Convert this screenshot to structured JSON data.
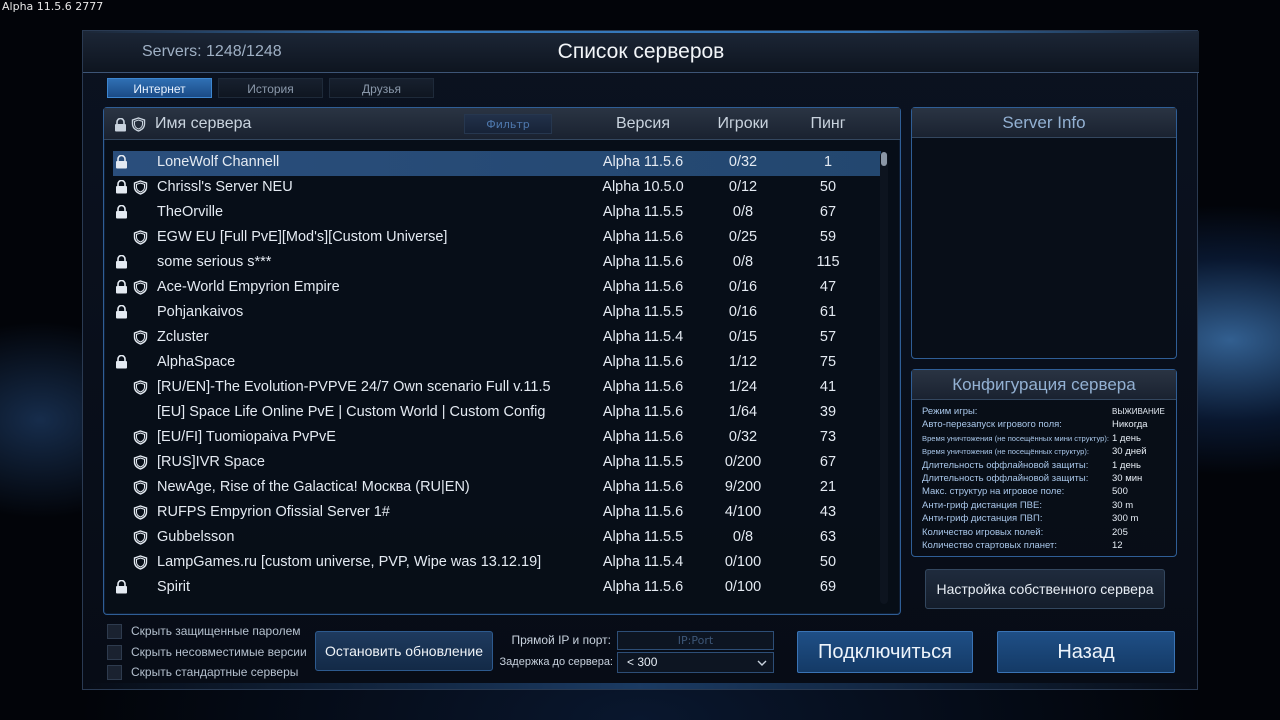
{
  "app": {
    "version_tag": "Alpha 11.5.6 2777"
  },
  "header": {
    "server_count": "Servers: 1248/1248",
    "title": "Список серверов"
  },
  "tabs": [
    {
      "label": "Интернет",
      "active": true
    },
    {
      "label": "История",
      "active": false
    },
    {
      "label": "Друзья",
      "active": false
    }
  ],
  "list": {
    "columns": {
      "name": "Имя сервера",
      "filter": "Фильтр",
      "version": "Версия",
      "players": "Игроки",
      "ping": "Пинг"
    },
    "selected_index": 0,
    "rows": [
      {
        "lock": true,
        "shield": false,
        "name": "LoneWolf Channell",
        "version": "Alpha 11.5.6",
        "players": "0/32",
        "ping": "1"
      },
      {
        "lock": true,
        "shield": true,
        "name": "Chrissl's Server NEU",
        "version": "Alpha 10.5.0",
        "players": "0/12",
        "ping": "50"
      },
      {
        "lock": true,
        "shield": false,
        "name": "TheOrville",
        "version": "Alpha 11.5.5",
        "players": "0/8",
        "ping": "67"
      },
      {
        "lock": false,
        "shield": true,
        "name": "EGW EU [Full PvE][Mod's][Custom Universe]",
        "version": "Alpha 11.5.6",
        "players": "0/25",
        "ping": "59"
      },
      {
        "lock": true,
        "shield": false,
        "name": "some serious s***",
        "version": "Alpha 11.5.6",
        "players": "0/8",
        "ping": "115"
      },
      {
        "lock": true,
        "shield": true,
        "name": "Ace-World Empyrion Empire",
        "version": "Alpha 11.5.6",
        "players": "0/16",
        "ping": "47"
      },
      {
        "lock": true,
        "shield": false,
        "name": "Pohjankaivos",
        "version": "Alpha 11.5.5",
        "players": "0/16",
        "ping": "61"
      },
      {
        "lock": false,
        "shield": true,
        "name": "Zcluster",
        "version": "Alpha 11.5.4",
        "players": "0/15",
        "ping": "57"
      },
      {
        "lock": true,
        "shield": false,
        "name": "AlphaSpace",
        "version": "Alpha 11.5.6",
        "players": "1/12",
        "ping": "75"
      },
      {
        "lock": false,
        "shield": true,
        "name": "[RU/EN]-The Evolution-PVPVE 24/7 Own scenario Full v.11.5",
        "version": "Alpha 11.5.6",
        "players": "1/24",
        "ping": "41"
      },
      {
        "lock": false,
        "shield": false,
        "name": "[EU] Space Life Online PvE | Custom World | Custom Config",
        "version": "Alpha 11.5.6",
        "players": "1/64",
        "ping": "39"
      },
      {
        "lock": false,
        "shield": true,
        "name": "[EU/FI] Tuomiopaiva PvPvE",
        "version": "Alpha 11.5.6",
        "players": "0/32",
        "ping": "73"
      },
      {
        "lock": false,
        "shield": true,
        "name": "[RUS]IVR Space",
        "version": "Alpha 11.5.5",
        "players": "0/200",
        "ping": "67"
      },
      {
        "lock": false,
        "shield": true,
        "name": "NewAge, Rise of the Galactica! Москва (RU|EN)",
        "version": "Alpha 11.5.6",
        "players": "9/200",
        "ping": "21"
      },
      {
        "lock": false,
        "shield": true,
        "name": "RUFPS Empyrion Ofissial Server 1#",
        "version": "Alpha 11.5.6",
        "players": "4/100",
        "ping": "43"
      },
      {
        "lock": false,
        "shield": true,
        "name": "Gubbelsson",
        "version": "Alpha 11.5.5",
        "players": "0/8",
        "ping": "63"
      },
      {
        "lock": false,
        "shield": true,
        "name": "LampGames.ru [custom universe, PVP, Wipe was 13.12.19]",
        "version": "Alpha 11.5.4",
        "players": "0/100",
        "ping": "50"
      },
      {
        "lock": true,
        "shield": false,
        "name": "Spirit",
        "version": "Alpha 11.5.6",
        "players": "0/100",
        "ping": "69"
      }
    ]
  },
  "server_info": {
    "title": "Server Info"
  },
  "config": {
    "title": "Конфигурация сервера",
    "items": [
      {
        "label": "Режим игры:",
        "value": "ВЫЖИВАНИЕ",
        "small_label": false,
        "small_value": true
      },
      {
        "label": "Авто-перезапуск игрового поля:",
        "value": "Никогда",
        "small_label": false,
        "small_value": false
      },
      {
        "label": "Время уничтожения (не посещённых мини структур):",
        "value": "1 день",
        "small_label": true,
        "small_value": false
      },
      {
        "label": "Время уничтожения (не посещённых структур):",
        "value": "30 дней",
        "small_label": true,
        "small_value": false
      },
      {
        "label": "Длительность оффлайновой защиты:",
        "value": "1 день",
        "small_label": false,
        "small_value": false
      },
      {
        "label": "Длительность оффлайновой защиты:",
        "value": "30 мин",
        "small_label": false,
        "small_value": false
      },
      {
        "label": "Макс. структур на игровое поле:",
        "value": "500",
        "small_label": false,
        "small_value": false
      },
      {
        "label": "Анти-гриф дистанция ПВЕ:",
        "value": "30 m",
        "small_label": false,
        "small_value": false
      },
      {
        "label": "Анти-гриф дистанция ПВП:",
        "value": "300 m",
        "small_label": false,
        "small_value": false
      },
      {
        "label": "Количество игровых полей:",
        "value": "205",
        "small_label": false,
        "small_value": false
      },
      {
        "label": "Количество стартовых планет:",
        "value": "12",
        "small_label": false,
        "small_value": false
      }
    ]
  },
  "footer": {
    "own_server_button": "Настройка собственного сервера",
    "checkboxes": [
      {
        "label": "Скрыть защищенные паролем",
        "checked": false
      },
      {
        "label": "Скрыть несовместимые версии",
        "checked": false
      },
      {
        "label": "Скрыть стандартные серверы",
        "checked": false
      }
    ],
    "stop_update_button": "Остановить обновление",
    "ip_label": "Прямой IP и порт:",
    "ip_placeholder": "IP:Port",
    "delay_label": "Задержка до сервера:",
    "delay_value": "< 300",
    "connect_button": "Подключиться",
    "back_button": "Назад"
  },
  "colors": {
    "accent": "#3a74b5",
    "selected_row": "#2a4e7c",
    "panel_border": "#2f5e96",
    "config_label": "#a9c7ea"
  },
  "icons": {
    "lock": "lock-icon",
    "shield": "shield-icon",
    "dropdown": "chevron-down-icon"
  }
}
